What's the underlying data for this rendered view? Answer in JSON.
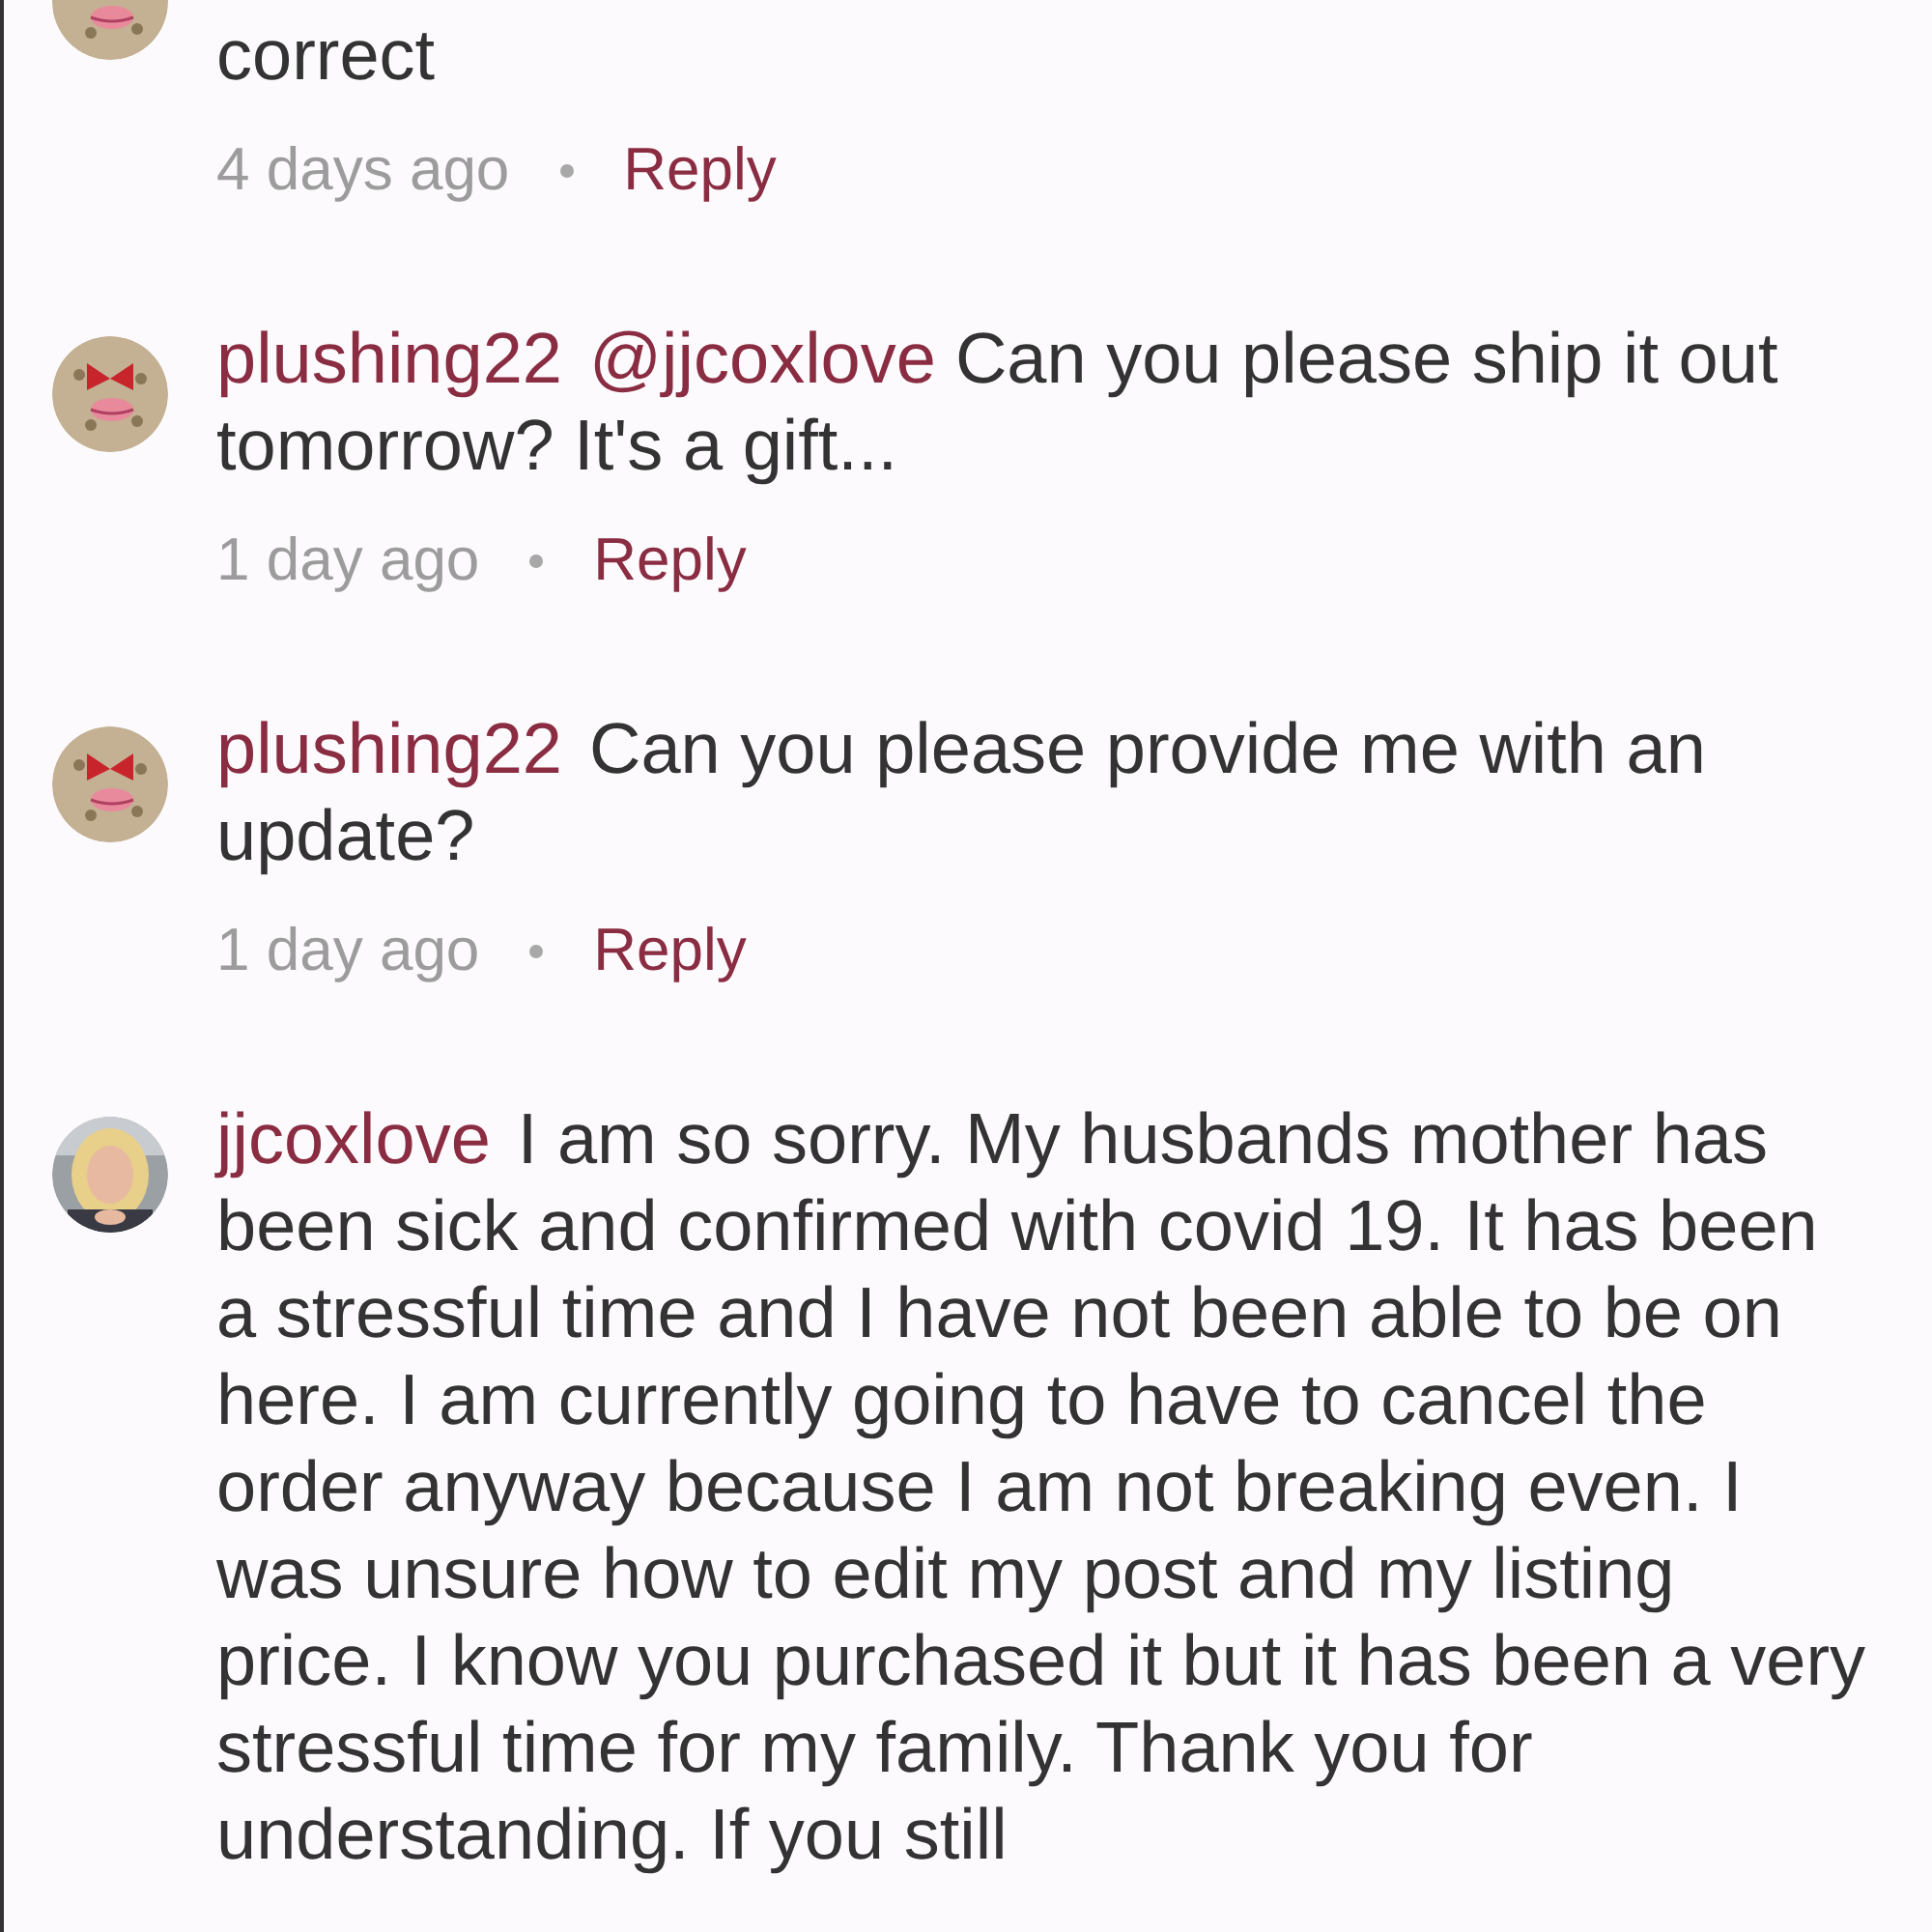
{
  "comments": [
    {
      "kind": "bag",
      "text": "correct",
      "time": "4 days ago",
      "reply": "Reply"
    },
    {
      "kind": "bag",
      "username": "plushing22",
      "mention": "@jjcoxlove",
      "text": "Can you please ship it out tomorrow? It's a gift...",
      "time": "1 day ago",
      "reply": "Reply"
    },
    {
      "kind": "bag",
      "username": "plushing22",
      "text": "Can you please provide me with an update?",
      "time": "1 day ago",
      "reply": "Reply"
    },
    {
      "username": "jjcoxlove",
      "text": "I am so sorry. My husbands mother has been sick and confirmed with covid 19. It has been a stressful time and I have not been able to be on here. I am currently going to have to cancel the order anyway because I am not breaking even. I was unsure how to edit my post and my listing price. I know you purchased it but it has been a very stressful time for my family. Thank you for understanding. If you still"
    }
  ]
}
